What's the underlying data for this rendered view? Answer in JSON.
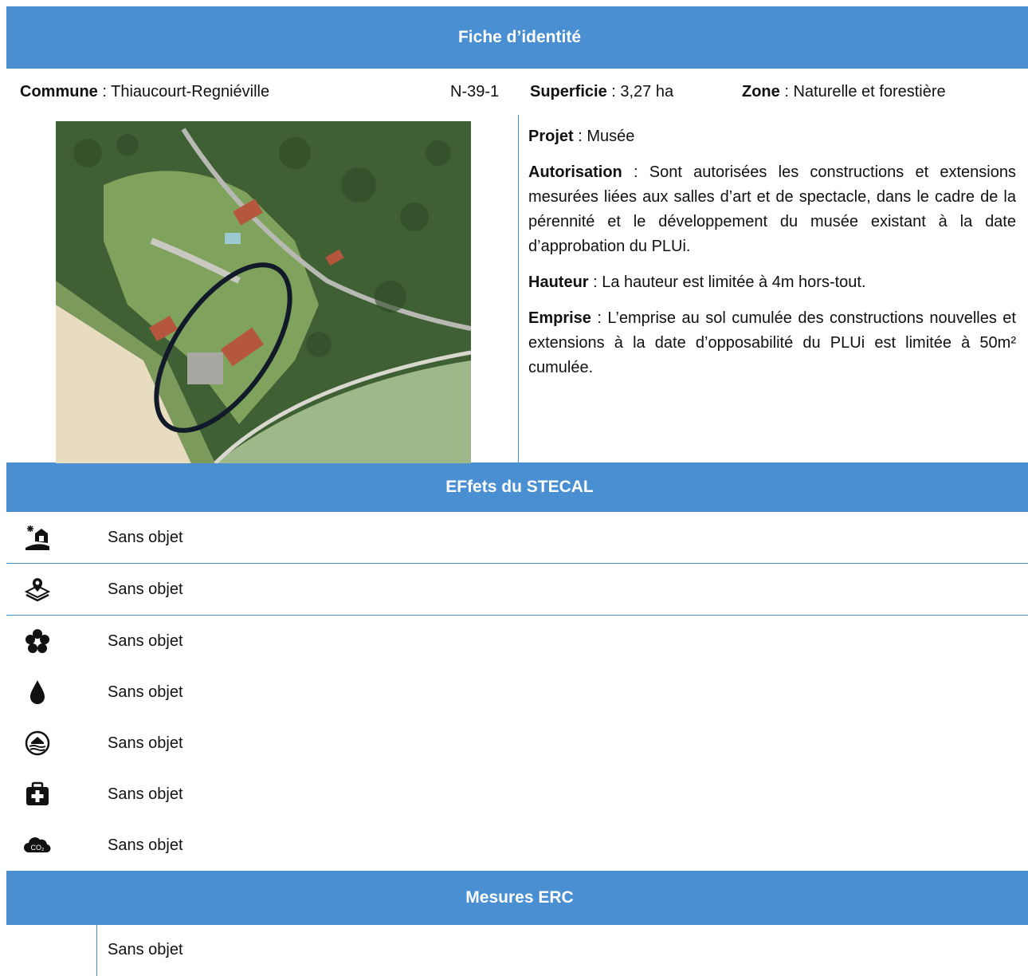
{
  "header": {
    "title": "Fiche d’identité"
  },
  "identity": {
    "commune_label": "Commune",
    "commune_value": " : Thiaucourt-Regniéville",
    "code": "N-39-1",
    "superficie_label": "Superficie",
    "superficie_value": " : 3,27 ha",
    "zone_label": "Zone",
    "zone_value": " : Naturelle et forestière"
  },
  "rules": {
    "projet_label": "Projet",
    "projet_value": " : Musée",
    "autorisation_label": "Autorisation",
    "autorisation_value": " : Sont autorisées les constructions et extensions mesurées liées aux salles d’art et de spectacle, dans le cadre de la pérennité et le développement du musée existant à la date d’approbation du PLUi.",
    "hauteur_label": "Hauteur",
    "hauteur_value": " : La hauteur est limitée à 4m hors-tout.",
    "emprise_label": "Emprise",
    "emprise_value": " : L’emprise au sol cumulée des constructions nouvelles et extensions à la date d’opposabilité du PLUi est limitée à 50m² cumulée."
  },
  "effects": {
    "title": "EFfets du STECAL",
    "items": [
      {
        "icon": "landscape-icon",
        "text": "Sans objet"
      },
      {
        "icon": "map-pin-layers-icon",
        "text": "Sans objet"
      },
      {
        "icon": "flower-icon",
        "text": "Sans objet"
      },
      {
        "icon": "water-drop-icon",
        "text": "Sans objet"
      },
      {
        "icon": "flood-risk-icon",
        "text": "Sans objet"
      },
      {
        "icon": "first-aid-kit-icon",
        "text": "Sans objet"
      },
      {
        "icon": "co2-cloud-icon",
        "text": "Sans objet",
        "icon_label": "CO₂"
      }
    ]
  },
  "erc": {
    "title": "Mesures ERC",
    "text": "Sans objet"
  },
  "colors": {
    "band": "#4a8fd1",
    "band_text": "#ffffff"
  }
}
